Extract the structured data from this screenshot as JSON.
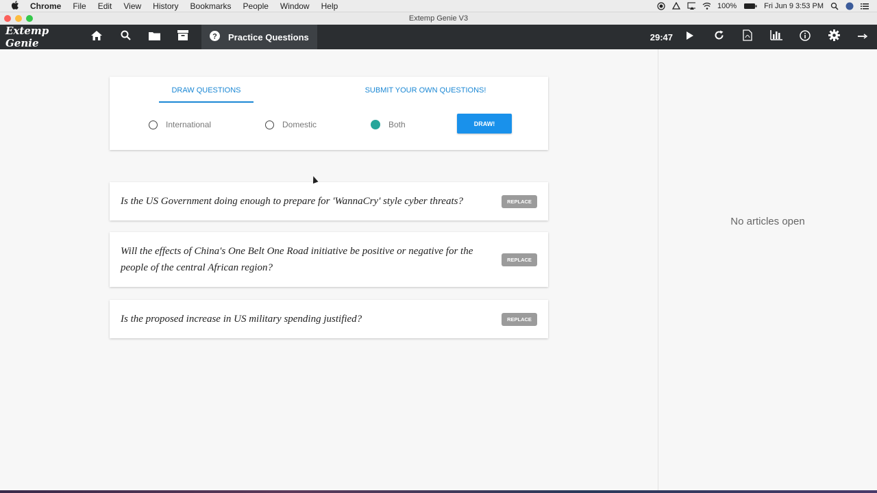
{
  "os_menubar": {
    "app_name": "Chrome",
    "menus": [
      "File",
      "Edit",
      "View",
      "History",
      "Bookmarks",
      "People",
      "Window",
      "Help"
    ],
    "battery": "100%",
    "datetime": "Fri Jun 9  3:53 PM"
  },
  "window": {
    "title": "Extemp Genie V3"
  },
  "toolbar": {
    "logo": "Extemp Genie",
    "active_section": "Practice Questions",
    "timer": "29:47",
    "icons": [
      "home-icon",
      "search-icon",
      "folder-icon",
      "archive-icon",
      "help-icon",
      "play-icon",
      "refresh-icon",
      "pdf-icon",
      "stats-icon",
      "info-icon",
      "gear-icon",
      "exit-icon"
    ]
  },
  "draw_panel": {
    "tabs": [
      {
        "label": "Draw Questions",
        "active": true
      },
      {
        "label": "Submit your own questions!",
        "active": false
      }
    ],
    "options": [
      {
        "label": "International",
        "selected": false
      },
      {
        "label": "Domestic",
        "selected": false
      },
      {
        "label": "Both",
        "selected": true
      }
    ],
    "draw_label": "Draw!"
  },
  "questions": [
    {
      "text": "Is the US Government doing enough to prepare for 'WannaCry' style cyber threats?",
      "action": "Replace"
    },
    {
      "text": "Will the effects of China's One Belt One Road initiative be positive or negative for the people of the central African region?",
      "action": "Replace"
    },
    {
      "text": "Is the proposed increase in US military spending justified?",
      "action": "Replace"
    }
  ],
  "sidebar": {
    "empty_message": "No articles open"
  },
  "colors": {
    "toolbar_bg": "#2b2e31",
    "accent_blue": "#1991eb",
    "radio_selected": "#26a69a",
    "replace_btn": "#9b9b9b"
  }
}
